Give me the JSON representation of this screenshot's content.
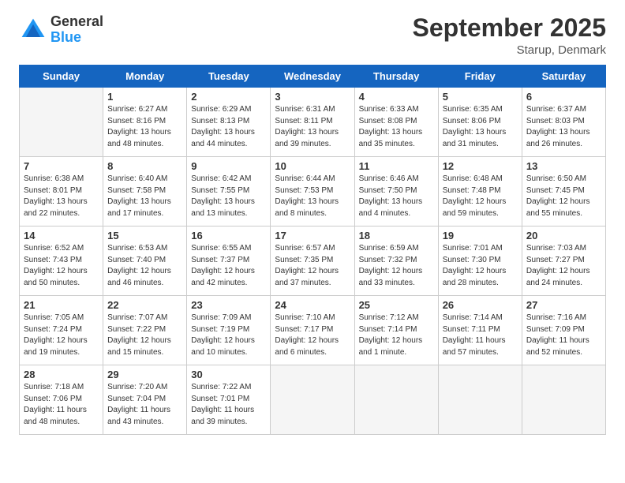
{
  "logo": {
    "general": "General",
    "blue": "Blue"
  },
  "title": {
    "month": "September 2025",
    "location": "Starup, Denmark"
  },
  "days_of_week": [
    "Sunday",
    "Monday",
    "Tuesday",
    "Wednesday",
    "Thursday",
    "Friday",
    "Saturday"
  ],
  "weeks": [
    [
      {
        "day": "",
        "info": ""
      },
      {
        "day": "1",
        "info": "Sunrise: 6:27 AM\nSunset: 8:16 PM\nDaylight: 13 hours\nand 48 minutes."
      },
      {
        "day": "2",
        "info": "Sunrise: 6:29 AM\nSunset: 8:13 PM\nDaylight: 13 hours\nand 44 minutes."
      },
      {
        "day": "3",
        "info": "Sunrise: 6:31 AM\nSunset: 8:11 PM\nDaylight: 13 hours\nand 39 minutes."
      },
      {
        "day": "4",
        "info": "Sunrise: 6:33 AM\nSunset: 8:08 PM\nDaylight: 13 hours\nand 35 minutes."
      },
      {
        "day": "5",
        "info": "Sunrise: 6:35 AM\nSunset: 8:06 PM\nDaylight: 13 hours\nand 31 minutes."
      },
      {
        "day": "6",
        "info": "Sunrise: 6:37 AM\nSunset: 8:03 PM\nDaylight: 13 hours\nand 26 minutes."
      }
    ],
    [
      {
        "day": "7",
        "info": "Sunrise: 6:38 AM\nSunset: 8:01 PM\nDaylight: 13 hours\nand 22 minutes."
      },
      {
        "day": "8",
        "info": "Sunrise: 6:40 AM\nSunset: 7:58 PM\nDaylight: 13 hours\nand 17 minutes."
      },
      {
        "day": "9",
        "info": "Sunrise: 6:42 AM\nSunset: 7:55 PM\nDaylight: 13 hours\nand 13 minutes."
      },
      {
        "day": "10",
        "info": "Sunrise: 6:44 AM\nSunset: 7:53 PM\nDaylight: 13 hours\nand 8 minutes."
      },
      {
        "day": "11",
        "info": "Sunrise: 6:46 AM\nSunset: 7:50 PM\nDaylight: 13 hours\nand 4 minutes."
      },
      {
        "day": "12",
        "info": "Sunrise: 6:48 AM\nSunset: 7:48 PM\nDaylight: 12 hours\nand 59 minutes."
      },
      {
        "day": "13",
        "info": "Sunrise: 6:50 AM\nSunset: 7:45 PM\nDaylight: 12 hours\nand 55 minutes."
      }
    ],
    [
      {
        "day": "14",
        "info": "Sunrise: 6:52 AM\nSunset: 7:43 PM\nDaylight: 12 hours\nand 50 minutes."
      },
      {
        "day": "15",
        "info": "Sunrise: 6:53 AM\nSunset: 7:40 PM\nDaylight: 12 hours\nand 46 minutes."
      },
      {
        "day": "16",
        "info": "Sunrise: 6:55 AM\nSunset: 7:37 PM\nDaylight: 12 hours\nand 42 minutes."
      },
      {
        "day": "17",
        "info": "Sunrise: 6:57 AM\nSunset: 7:35 PM\nDaylight: 12 hours\nand 37 minutes."
      },
      {
        "day": "18",
        "info": "Sunrise: 6:59 AM\nSunset: 7:32 PM\nDaylight: 12 hours\nand 33 minutes."
      },
      {
        "day": "19",
        "info": "Sunrise: 7:01 AM\nSunset: 7:30 PM\nDaylight: 12 hours\nand 28 minutes."
      },
      {
        "day": "20",
        "info": "Sunrise: 7:03 AM\nSunset: 7:27 PM\nDaylight: 12 hours\nand 24 minutes."
      }
    ],
    [
      {
        "day": "21",
        "info": "Sunrise: 7:05 AM\nSunset: 7:24 PM\nDaylight: 12 hours\nand 19 minutes."
      },
      {
        "day": "22",
        "info": "Sunrise: 7:07 AM\nSunset: 7:22 PM\nDaylight: 12 hours\nand 15 minutes."
      },
      {
        "day": "23",
        "info": "Sunrise: 7:09 AM\nSunset: 7:19 PM\nDaylight: 12 hours\nand 10 minutes."
      },
      {
        "day": "24",
        "info": "Sunrise: 7:10 AM\nSunset: 7:17 PM\nDaylight: 12 hours\nand 6 minutes."
      },
      {
        "day": "25",
        "info": "Sunrise: 7:12 AM\nSunset: 7:14 PM\nDaylight: 12 hours\nand 1 minute."
      },
      {
        "day": "26",
        "info": "Sunrise: 7:14 AM\nSunset: 7:11 PM\nDaylight: 11 hours\nand 57 minutes."
      },
      {
        "day": "27",
        "info": "Sunrise: 7:16 AM\nSunset: 7:09 PM\nDaylight: 11 hours\nand 52 minutes."
      }
    ],
    [
      {
        "day": "28",
        "info": "Sunrise: 7:18 AM\nSunset: 7:06 PM\nDaylight: 11 hours\nand 48 minutes."
      },
      {
        "day": "29",
        "info": "Sunrise: 7:20 AM\nSunset: 7:04 PM\nDaylight: 11 hours\nand 43 minutes."
      },
      {
        "day": "30",
        "info": "Sunrise: 7:22 AM\nSunset: 7:01 PM\nDaylight: 11 hours\nand 39 minutes."
      },
      {
        "day": "",
        "info": ""
      },
      {
        "day": "",
        "info": ""
      },
      {
        "day": "",
        "info": ""
      },
      {
        "day": "",
        "info": ""
      }
    ]
  ]
}
